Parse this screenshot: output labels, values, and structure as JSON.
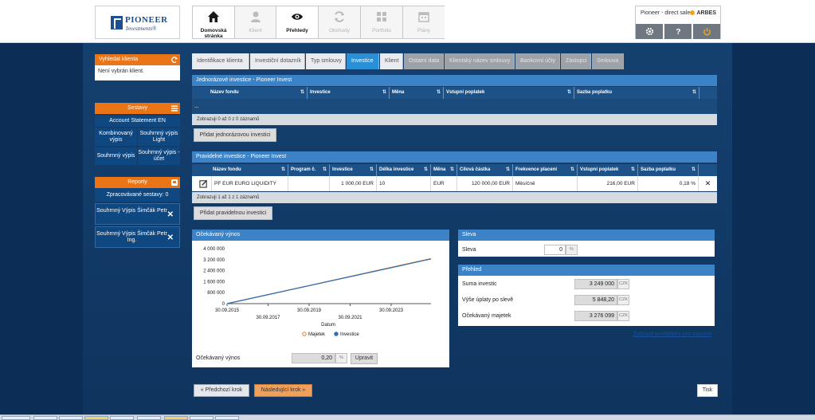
{
  "logo": {
    "line1": "PIONEER",
    "line2": "Investments®"
  },
  "nav": [
    {
      "label": "Domovská stránka",
      "icon": "home-icon",
      "active": true
    },
    {
      "label": "Klient",
      "icon": "person-icon",
      "active": false
    },
    {
      "label": "Přehledy",
      "icon": "eye-icon",
      "active": true
    },
    {
      "label": "Obchody",
      "icon": "refresh-icon",
      "active": false
    },
    {
      "label": "Portfolio",
      "icon": "grid-icon",
      "active": false
    },
    {
      "label": "Plány",
      "icon": "calendar-icon",
      "active": false
    }
  ],
  "user": {
    "name": "Pioneer - direct sale",
    "brand": "ARBES"
  },
  "sidebar": {
    "search": {
      "title": "Vyhledat klienta",
      "body": "Není vybrán klient."
    },
    "reports_section": {
      "title": "Sestavy",
      "items": [
        "Account Statement EN",
        "Kombinovaný výpis",
        "Souhrnný výpis Light",
        "Souhrnný výpis",
        "Souhrnný výpis - účet"
      ]
    },
    "reporty": {
      "title": "Reporty",
      "processing": "Zpracovávané sestavy: 0",
      "items": [
        "Souhrnný Výpis Šimčák Petr",
        "Souhrnný Výpis Šimčák Petr Ing."
      ]
    }
  },
  "steps": [
    "Identifikace klienta",
    "Investiční dotazník",
    "Typ smlouvy",
    "Investice",
    "Klient",
    "Ostatní data",
    "Klientský název smlouvy",
    "Bankovní účty",
    "Zástupci",
    "Smlouva"
  ],
  "one_time": {
    "title": "Jednorázové investice - Pioneer Invest",
    "columns": [
      "Název fondu",
      "Investice",
      "Měna",
      "Vstupní poplatek",
      "Sazba poplatku"
    ],
    "empty_row": "...",
    "footer": "Zobrazuji 0 až 0 z 0 záznamů",
    "add_button": "Přidat jednorázovou investici"
  },
  "regular": {
    "title": "Pravidelné investice - Pioneer Invest",
    "columns": [
      "Název fondu",
      "Program č.",
      "Investice",
      "Délka investice",
      "Měna",
      "Cílová částka",
      "Frekvence placení",
      "Vstupní poplatek",
      "Sazba poplatku"
    ],
    "rows": [
      [
        "PF EUR EURO LIQUIDITY",
        "",
        "1 000,00 EUR",
        "10",
        "EUR",
        "120 000,00 EUR",
        "Měsíčně",
        "216,00 EUR",
        "0,18 %"
      ]
    ],
    "footer": "Zobrazuji 1 až 1 z 1 záznamů",
    "add_button": "Přidat pravidelnou investici"
  },
  "expected": {
    "title": "Očekávaný výnos",
    "field_label": "Očekávaný výnos",
    "field_value": "0,20",
    "field_unit": "%",
    "update_button": "Upravit"
  },
  "chart_data": {
    "type": "line",
    "xlabel": "Datum",
    "x_ticks_upper": [
      "30.09.2015",
      "30.09.2019",
      "30.09.2023"
    ],
    "x_ticks_lower": [
      "30.09.2017",
      "30.09.2021"
    ],
    "y_ticks": [
      "0",
      "800 000",
      "1 600 000",
      "2 400 000",
      "3 200 000",
      "4 000 000"
    ],
    "ylim": [
      0,
      4000000
    ],
    "x": [
      "30.09.2015",
      "30.09.2025"
    ],
    "series": [
      {
        "name": "Majetek",
        "values": [
          0,
          3276099
        ],
        "color": "#e07a2a"
      },
      {
        "name": "Investice",
        "values": [
          0,
          3249000
        ],
        "color": "#2a6fb5"
      }
    ]
  },
  "discount": {
    "title": "Sleva",
    "label": "Sleva",
    "value": "0",
    "unit": "%"
  },
  "overview": {
    "title": "Přehled",
    "rows": [
      {
        "label": "Suma investic",
        "value": "3 249 000",
        "unit": "CZK"
      },
      {
        "label": "Výše úplaty po slevě",
        "value": "5 848,20",
        "unit": "CZK"
      },
      {
        "label": "Očekávaný majetek",
        "value": "3 276 099",
        "unit": "CZK"
      }
    ],
    "link": "Zobrazit prohlášení pro výpočet"
  },
  "buttons": {
    "prev": "Předchozí krok",
    "next": "Následující krok",
    "print": "Tisk"
  }
}
